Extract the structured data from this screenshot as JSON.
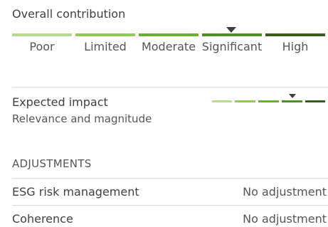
{
  "overall": {
    "title": "Overall contribution",
    "levels": [
      "Poor",
      "Limited",
      "Moderate",
      "Significant",
      "High"
    ],
    "selected_level": "Significant",
    "colors": [
      "#b5dc8a",
      "#8fcb4e",
      "#6ab02c",
      "#4e8f22",
      "#345f18"
    ]
  },
  "impact": {
    "title": "Expected impact",
    "subtitle": "Relevance and magnitude",
    "selected_level": "Significant",
    "colors": [
      "#b5dc8a",
      "#8fcb4e",
      "#6ab02c",
      "#4e8f22",
      "#345f18"
    ]
  },
  "adjustments": {
    "heading": "ADJUSTMENTS",
    "rows": [
      {
        "label": "ESG risk management",
        "value": "No adjustment"
      },
      {
        "label": "Coherence",
        "value": "No adjustment"
      }
    ]
  },
  "marker_color": "#3d3d3d",
  "divider_color": "#dcdcdc"
}
